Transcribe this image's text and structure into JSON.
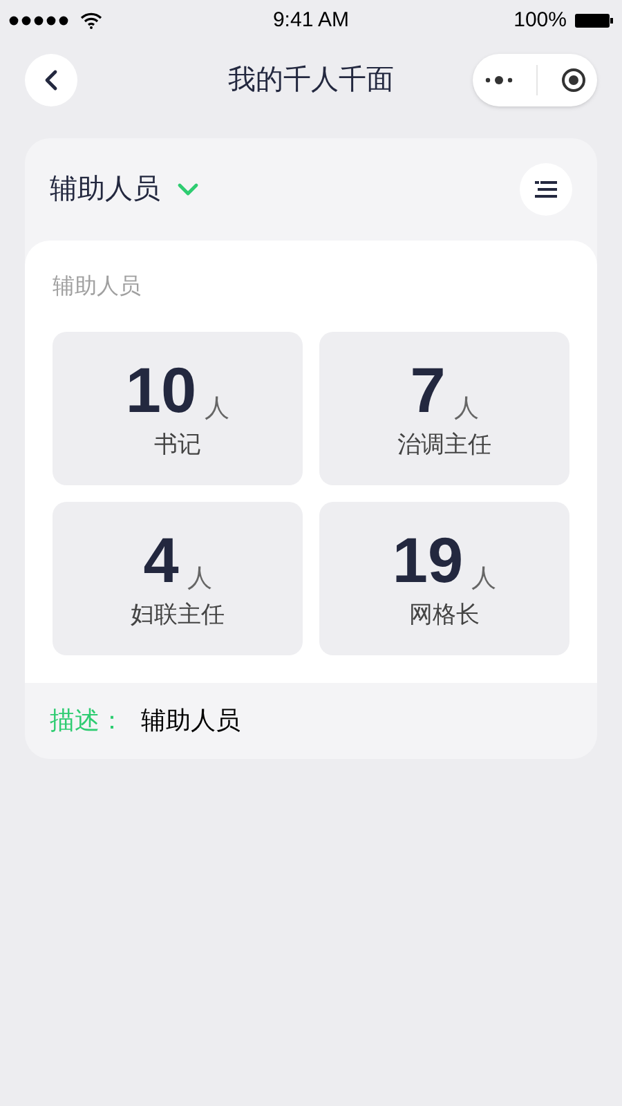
{
  "status_bar": {
    "time": "9:41 AM",
    "battery": "100%"
  },
  "nav": {
    "title": "我的千人千面"
  },
  "selector": {
    "label": "辅助人员"
  },
  "section": {
    "title": "辅助人员",
    "stats": [
      {
        "count": "10",
        "unit": "人",
        "label": "书记"
      },
      {
        "count": "7",
        "unit": "人",
        "label": "治调主任"
      },
      {
        "count": "4",
        "unit": "人",
        "label": "妇联主任"
      },
      {
        "count": "19",
        "unit": "人",
        "label": "网格长"
      }
    ]
  },
  "description": {
    "label": "描述：",
    "value": "辅助人员"
  }
}
